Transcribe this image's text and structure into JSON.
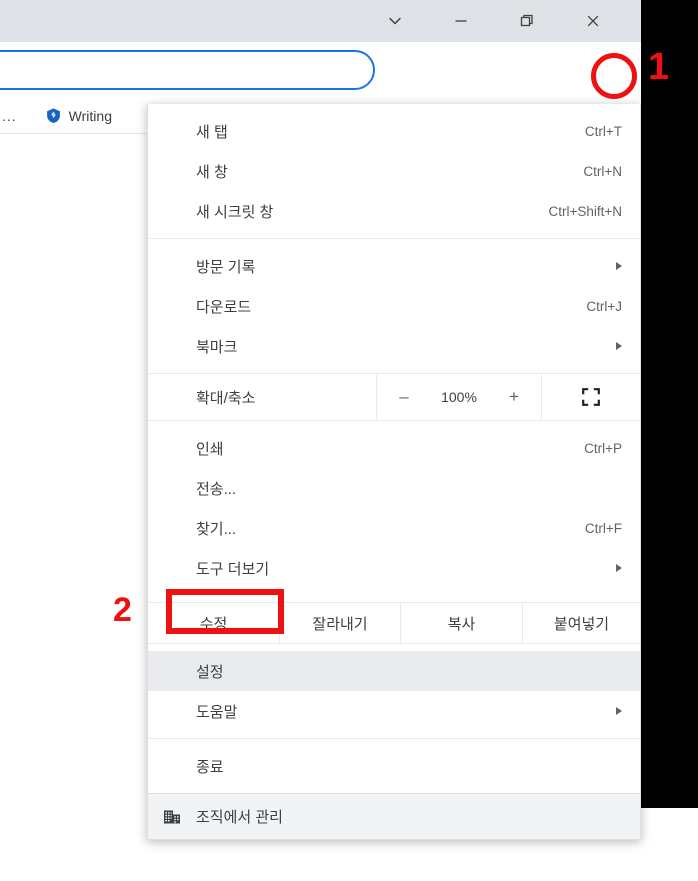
{
  "window": {
    "controls": [
      {
        "name": "tab-search",
        "icon": "chevron-down-icon"
      },
      {
        "name": "minimize",
        "icon": "minimize-icon"
      },
      {
        "name": "maximize",
        "icon": "restore-icon"
      },
      {
        "name": "close",
        "icon": "close-icon"
      }
    ]
  },
  "toolbar": {
    "omnibox_value": "",
    "omnibox_placeholder": "",
    "icons": [
      {
        "name": "extensions",
        "icon": "puzzle-icon"
      },
      {
        "name": "downloads",
        "icon": "download-icon"
      },
      {
        "name": "side-panel",
        "icon": "side-panel-icon"
      },
      {
        "name": "profile",
        "icon": "avatar-icon"
      },
      {
        "name": "more",
        "icon": "three-dot-icon"
      }
    ]
  },
  "bookmarks": {
    "overflow_label": "...",
    "items": [
      {
        "label": "Writing",
        "icon": "shield-icon"
      }
    ]
  },
  "menu": {
    "group1": [
      {
        "label": "새 탭",
        "accel": "Ctrl+T"
      },
      {
        "label": "새 창",
        "accel": "Ctrl+N"
      },
      {
        "label": "새 시크릿 창",
        "accel": "Ctrl+Shift+N"
      }
    ],
    "group2": [
      {
        "label": "방문 기록",
        "accel": "",
        "submenu": true
      },
      {
        "label": "다운로드",
        "accel": "Ctrl+J",
        "submenu": false
      },
      {
        "label": "북마크",
        "accel": "",
        "submenu": true
      }
    ],
    "zoom": {
      "label": "확대/축소",
      "minus": "–",
      "level": "100%",
      "plus": "+",
      "fullscreen_icon": "fullscreen-icon"
    },
    "group3": [
      {
        "label": "인쇄",
        "accel": "Ctrl+P",
        "submenu": false
      },
      {
        "label": "전송...",
        "accel": "",
        "submenu": false
      },
      {
        "label": "찾기...",
        "accel": "Ctrl+F",
        "submenu": false
      },
      {
        "label": "도구 더보기",
        "accel": "",
        "submenu": true
      }
    ],
    "edit": {
      "label": "수정",
      "cut": "잘라내기",
      "copy": "복사",
      "paste": "붙여넣기"
    },
    "group4": [
      {
        "label": "설정",
        "accel": "",
        "submenu": false,
        "highlight": true
      },
      {
        "label": "도움말",
        "accel": "",
        "submenu": true,
        "highlight": false
      }
    ],
    "group5": [
      {
        "label": "종료",
        "accel": "",
        "submenu": false
      }
    ],
    "managed": {
      "label": "조직에서 관리",
      "icon": "building-icon"
    }
  },
  "annotations": {
    "step1": "1",
    "step2": "2",
    "color": "#ee1111"
  }
}
